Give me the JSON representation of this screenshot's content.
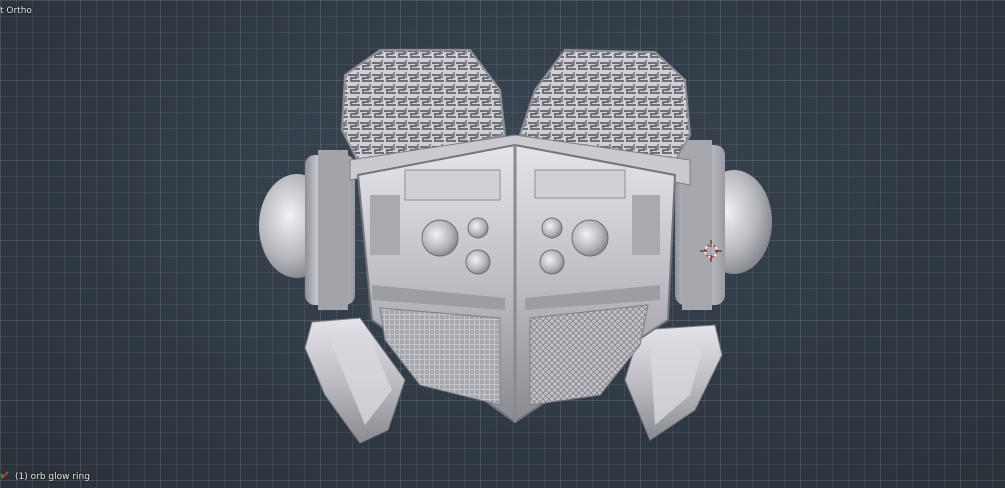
{
  "viewport": {
    "view_name": "t Ortho",
    "object_label": "(1) orb glow ring"
  },
  "colors": {
    "background": "#2f3842",
    "grid": "#4a5560",
    "model_base": "#b9b9bf",
    "model_light": "#e2e2e8",
    "model_shadow": "#7e7e86",
    "cursor_red": "#e03030"
  },
  "icons": {
    "cursor": "3d-cursor-icon",
    "axis": "axis-icon"
  }
}
